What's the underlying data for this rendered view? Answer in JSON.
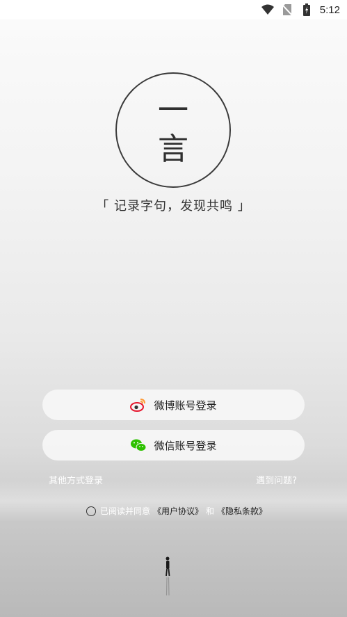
{
  "status_bar": {
    "time": "5:12",
    "icons": [
      "wifi-icon",
      "no-sim-icon",
      "battery-charging-icon"
    ]
  },
  "logo": {
    "char_top": "一",
    "char_bottom": "言"
  },
  "slogan": "「 记录字句，发现共鸣 」",
  "buttons": {
    "weibo_label": "微博账号登录",
    "weibo_icon": "weibo-icon",
    "wechat_label": "微信账号登录",
    "wechat_icon": "wechat-icon"
  },
  "links": {
    "other_login": "其他方式登录",
    "help": "遇到问题?"
  },
  "agreement": {
    "prefix": "已阅读并同意",
    "user_agreement": "《用户协议》",
    "and": "和",
    "privacy": "《隐私条款》"
  },
  "colors": {
    "weibo_red": "#e6162d",
    "weibo_orange": "#ff9933",
    "wechat_green": "#2dc100"
  }
}
